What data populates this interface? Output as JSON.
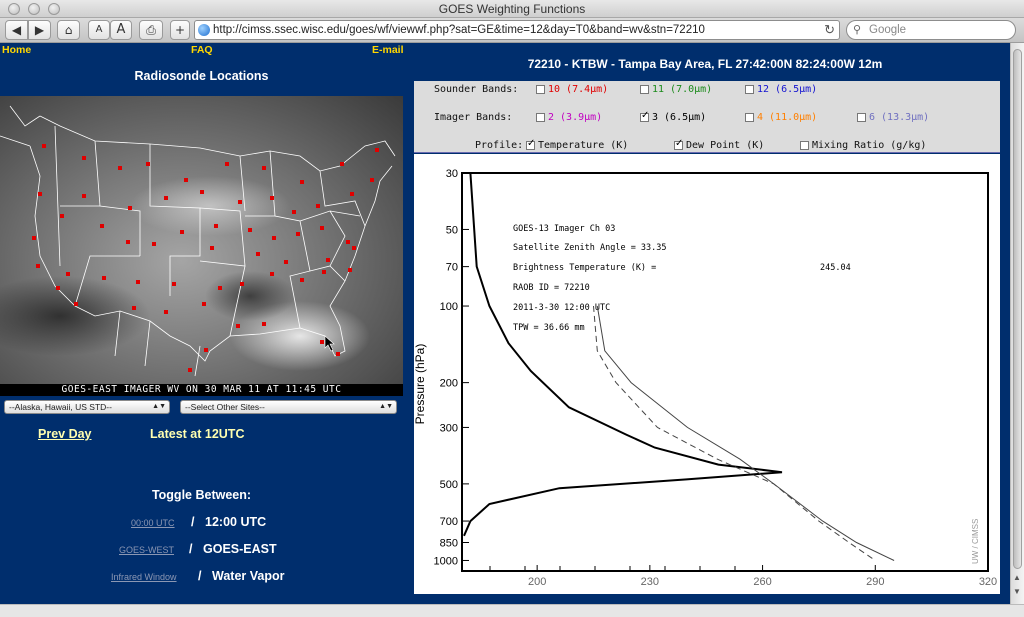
{
  "window": {
    "title": "GOES Weighting Functions"
  },
  "toolbar": {
    "back": "◀",
    "forward": "▶",
    "home": "⌂",
    "text_smaller": "A",
    "text_larger": "A",
    "print": "⎙",
    "add": "+",
    "url": "http://cimss.ssec.wisc.edu/goes/wf/viewwf.php?sat=GE&time=12&day=T0&band=wv&stn=72210",
    "search_placeholder": "Google"
  },
  "nav": {
    "home": "Home",
    "faq": "FAQ",
    "email": "E-mail"
  },
  "left": {
    "title": "Radiosonde Locations",
    "map_caption": "GOES-EAST IMAGER WV ON 30 MAR 11 AT 11:45 UTC",
    "select_1": "--Alaska, Hawaii, US STD--",
    "select_2": "--Select Other Sites--",
    "prev_day": "Prev Day",
    "latest": "Latest at 12UTC",
    "toggle_title": "Toggle Between:",
    "toggles": [
      {
        "link": "00:00 UTC",
        "current": "12:00 UTC"
      },
      {
        "link": "GOES-WEST",
        "current": "GOES-EAST"
      },
      {
        "link": "Infrared Window",
        "current": "Water Vapor"
      }
    ],
    "slash": "/"
  },
  "station_title": "72210 - KTBW - Tampa Bay Area, FL 27:42:00N 82:24:00W 12m",
  "bands": {
    "sounder_label": "Sounder Bands:",
    "imager_label": "Imager  Bands:",
    "profile_label": "Profile:",
    "sounder": [
      {
        "label": "10 (7.4μm)",
        "color": "#e00000",
        "checked": false
      },
      {
        "label": "11 (7.0μm)",
        "color": "#1a8a1a",
        "checked": false
      },
      {
        "label": "12 (6.5μm)",
        "color": "#1414d0",
        "checked": false
      }
    ],
    "imager": [
      {
        "label": "2 (3.9μm)",
        "color": "#c000c0",
        "checked": false
      },
      {
        "label": "3 (6.5μm)",
        "color": "#000000",
        "checked": true
      },
      {
        "label": "4 (11.0μm)",
        "color": "#ff7f00",
        "checked": false
      },
      {
        "label": "6 (13.3μm)",
        "color": "#7070c0",
        "checked": false
      }
    ],
    "profile": [
      {
        "label": "Temperature (K)",
        "checked": true
      },
      {
        "label": "Dew Point (K)",
        "checked": true
      },
      {
        "label": "Mixing Ratio (g/kg)",
        "checked": false
      }
    ]
  },
  "plot": {
    "info": [
      "GOES-13 Imager  Ch    03",
      "Satellite Zenith Angle = 33.35",
      "Brightness Temperature (K) =",
      "RAOB ID = 72210",
      "2011-3-30 12:00 UTC",
      "TPW = 36.66 mm"
    ],
    "bt_value": "245.04",
    "watermark": "UW / CIMSS"
  },
  "chart_data": {
    "type": "line",
    "title": "",
    "ylabel": "Pressure (hPa)",
    "xlabel": "",
    "y_scale": "log",
    "y_ticks": [
      30,
      50,
      70,
      100,
      200,
      300,
      500,
      700,
      850,
      1000
    ],
    "x_ticks": [
      200,
      230,
      260,
      290,
      320
    ],
    "xlim": [
      180,
      320
    ],
    "ylim": [
      1100,
      30
    ],
    "grid": false,
    "series": [
      {
        "role": "weighting_function",
        "points": [
          [
            0.02,
            30
          ],
          [
            0.04,
            70
          ],
          [
            0.08,
            100
          ],
          [
            0.14,
            140
          ],
          [
            0.21,
            180
          ],
          [
            0.33,
            250
          ],
          [
            0.51,
            320
          ],
          [
            0.6,
            360
          ],
          [
            0.8,
            420
          ],
          [
            1.0,
            450
          ],
          [
            0.7,
            480
          ],
          [
            0.3,
            520
          ],
          [
            0.08,
            600
          ],
          [
            0.02,
            700
          ],
          [
            0.0,
            800
          ]
        ]
      },
      {
        "role": "temperature",
        "points": [
          [
            216,
            100
          ],
          [
            218,
            150
          ],
          [
            225,
            200
          ],
          [
            240,
            300
          ],
          [
            254,
            400
          ],
          [
            263,
            500
          ],
          [
            276,
            700
          ],
          [
            285,
            850
          ],
          [
            295,
            1000
          ]
        ]
      },
      {
        "role": "dew_point",
        "points": [
          [
            215,
            100
          ],
          [
            216,
            150
          ],
          [
            221,
            200
          ],
          [
            232,
            300
          ],
          [
            248,
            400
          ],
          [
            263,
            500
          ],
          [
            275,
            700
          ],
          [
            283,
            850
          ],
          [
            290,
            1000
          ]
        ]
      }
    ]
  }
}
